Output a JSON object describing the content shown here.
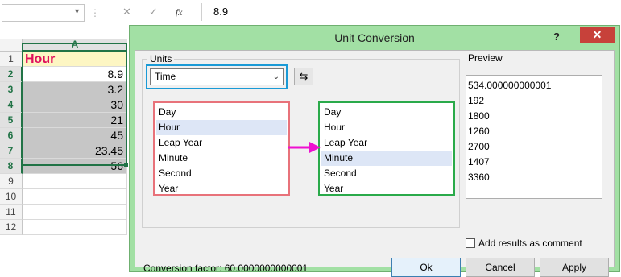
{
  "excel": {
    "formula_value": "8.9",
    "fx_label": "fx",
    "column_header": "A",
    "row_numbers": [
      "1",
      "2",
      "3",
      "4",
      "5",
      "6",
      "7",
      "8",
      "9",
      "10",
      "11",
      "12"
    ],
    "cells": [
      "Hour",
      "8.9",
      "3.2",
      "30",
      "21",
      "45",
      "23.45",
      "56"
    ]
  },
  "dialog": {
    "title": "Unit Conversion",
    "help_label": "?",
    "close_label": "✕",
    "units_label": "Units",
    "category_value": "Time",
    "from_units": [
      "Day",
      "Hour",
      "Leap Year",
      "Minute",
      "Second",
      "Year"
    ],
    "from_selected": "Hour",
    "to_units": [
      "Day",
      "Hour",
      "Leap Year",
      "Minute",
      "Second",
      "Year"
    ],
    "to_selected": "Minute",
    "preview_label": "Preview",
    "preview_values": [
      "534.000000000001",
      "192",
      "1800",
      "1260",
      "2700",
      "1407",
      "3360"
    ],
    "add_comment_label": "Add results as comment",
    "add_comment_checked": false,
    "conversion_factor": "Conversion factor: 60.0000000000001",
    "ok_label": "Ok",
    "cancel_label": "Cancel",
    "apply_label": "Apply"
  },
  "colors": {
    "dialog_frame": "#a2e0a4",
    "header_text": "#e0105c",
    "header_fill": "#fdf6c3",
    "highlight_blue": "#1a9ad6",
    "highlight_red": "#e8727a",
    "highlight_green": "#2aaa4a",
    "arrow": "#ee10d0",
    "excel_green": "#217346"
  }
}
